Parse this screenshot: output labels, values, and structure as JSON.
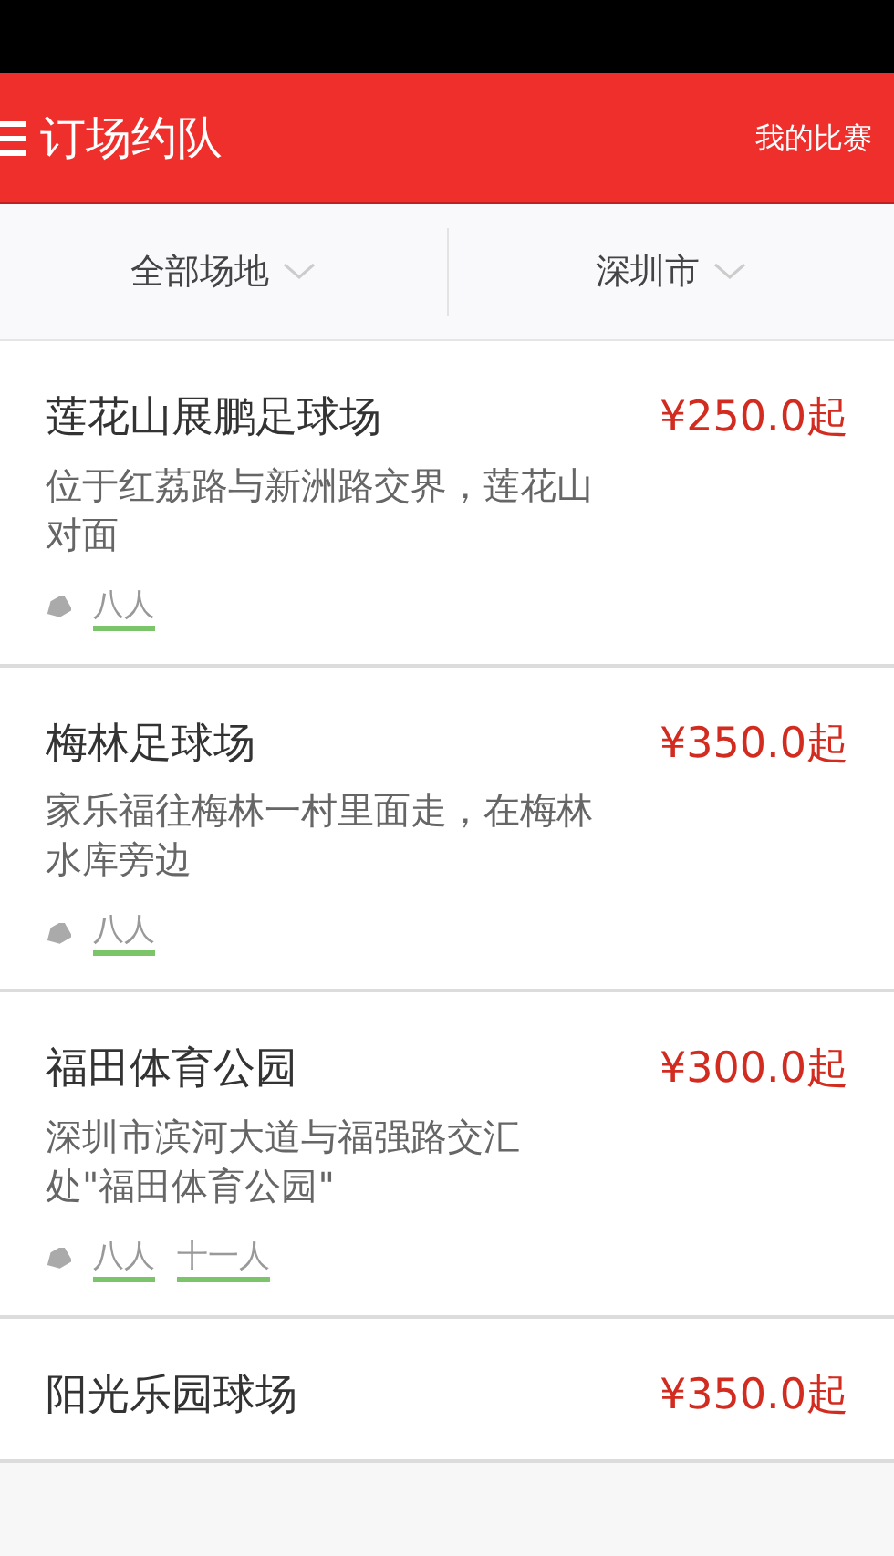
{
  "header": {
    "title": "订场约队",
    "action": "我的比赛"
  },
  "filters": [
    {
      "label": "全部场地"
    },
    {
      "label": "深圳市"
    }
  ],
  "venues": [
    {
      "name": "莲花山展鹏足球场",
      "price": "¥250.0起",
      "address": "位于红荔路与新洲路交界，莲花山对面",
      "tags": [
        "八人"
      ]
    },
    {
      "name": "梅林足球场",
      "price": "¥350.0起",
      "address": "家乐福往梅林一村里面走，在梅林水库旁边",
      "tags": [
        "八人"
      ]
    },
    {
      "name": "福田体育公园",
      "price": "¥300.0起",
      "address": "深圳市滨河大道与福强路交汇处\"福田体育公园\"",
      "tags": [
        "八人",
        "十一人"
      ]
    },
    {
      "name": "阳光乐园球场",
      "price": "¥350.0起"
    }
  ]
}
